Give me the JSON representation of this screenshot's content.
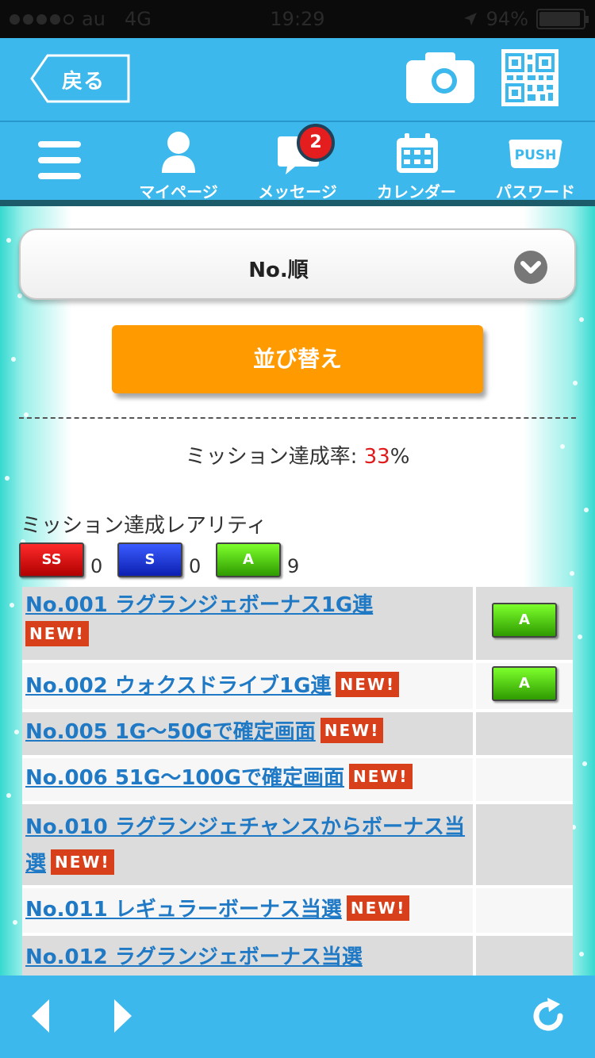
{
  "status": {
    "carrier": "au",
    "network": "4G",
    "time": "19:29",
    "battery": "94%",
    "battery_level": 0.94
  },
  "header": {
    "back_label": "戻る",
    "camera_icon": "camera-icon",
    "qr_icon": "qr-code-icon"
  },
  "nav": {
    "menu_icon": "hamburger-menu-icon",
    "items": [
      {
        "label": "マイページ",
        "icon": "person-icon"
      },
      {
        "label": "メッセージ",
        "icon": "message-bubble-icon",
        "badge": "2"
      },
      {
        "label": "カレンダー",
        "icon": "calendar-icon"
      },
      {
        "label": "パスワード",
        "icon": "push-icon",
        "icon_text": "PUSH"
      }
    ]
  },
  "main": {
    "sort_select": "No.順",
    "sort_button": "並び替え",
    "rate_label": "ミッション達成率: ",
    "rate_value": "33",
    "rate_unit": "%",
    "rarity_title": "ミッション達成レアリティ",
    "rarity": [
      {
        "label": "SS",
        "count": "0",
        "color": "#d40000"
      },
      {
        "label": "S",
        "count": "0",
        "color": "#1a33d8"
      },
      {
        "label": "A",
        "count": "9",
        "color": "#4cc414"
      }
    ],
    "new_label": "NEW!",
    "missions": [
      {
        "title": "No.001 ラグランジェボーナス1G連",
        "new": true,
        "new_break": true,
        "rarity": "A"
      },
      {
        "title": "No.002 ウォクスドライブ1G連",
        "new": true,
        "rarity": "A"
      },
      {
        "title": "No.005 1G〜50Gで確定画面",
        "new": true,
        "rarity": ""
      },
      {
        "title": "No.006 51G〜100Gで確定画面",
        "new": true,
        "rarity": ""
      },
      {
        "title": "No.010 ラグランジェチャンスからボーナス当選",
        "new": true,
        "rarity": ""
      },
      {
        "title": "No.011 レギュラーボーナス当選",
        "new": true,
        "rarity": ""
      },
      {
        "title": "No.012 ラグランジェボーナス当選",
        "new": false,
        "rarity": ""
      }
    ]
  },
  "bottom": {
    "back_icon": "arrow-left-icon",
    "forward_icon": "arrow-right-icon",
    "reload_icon": "reload-icon"
  }
}
